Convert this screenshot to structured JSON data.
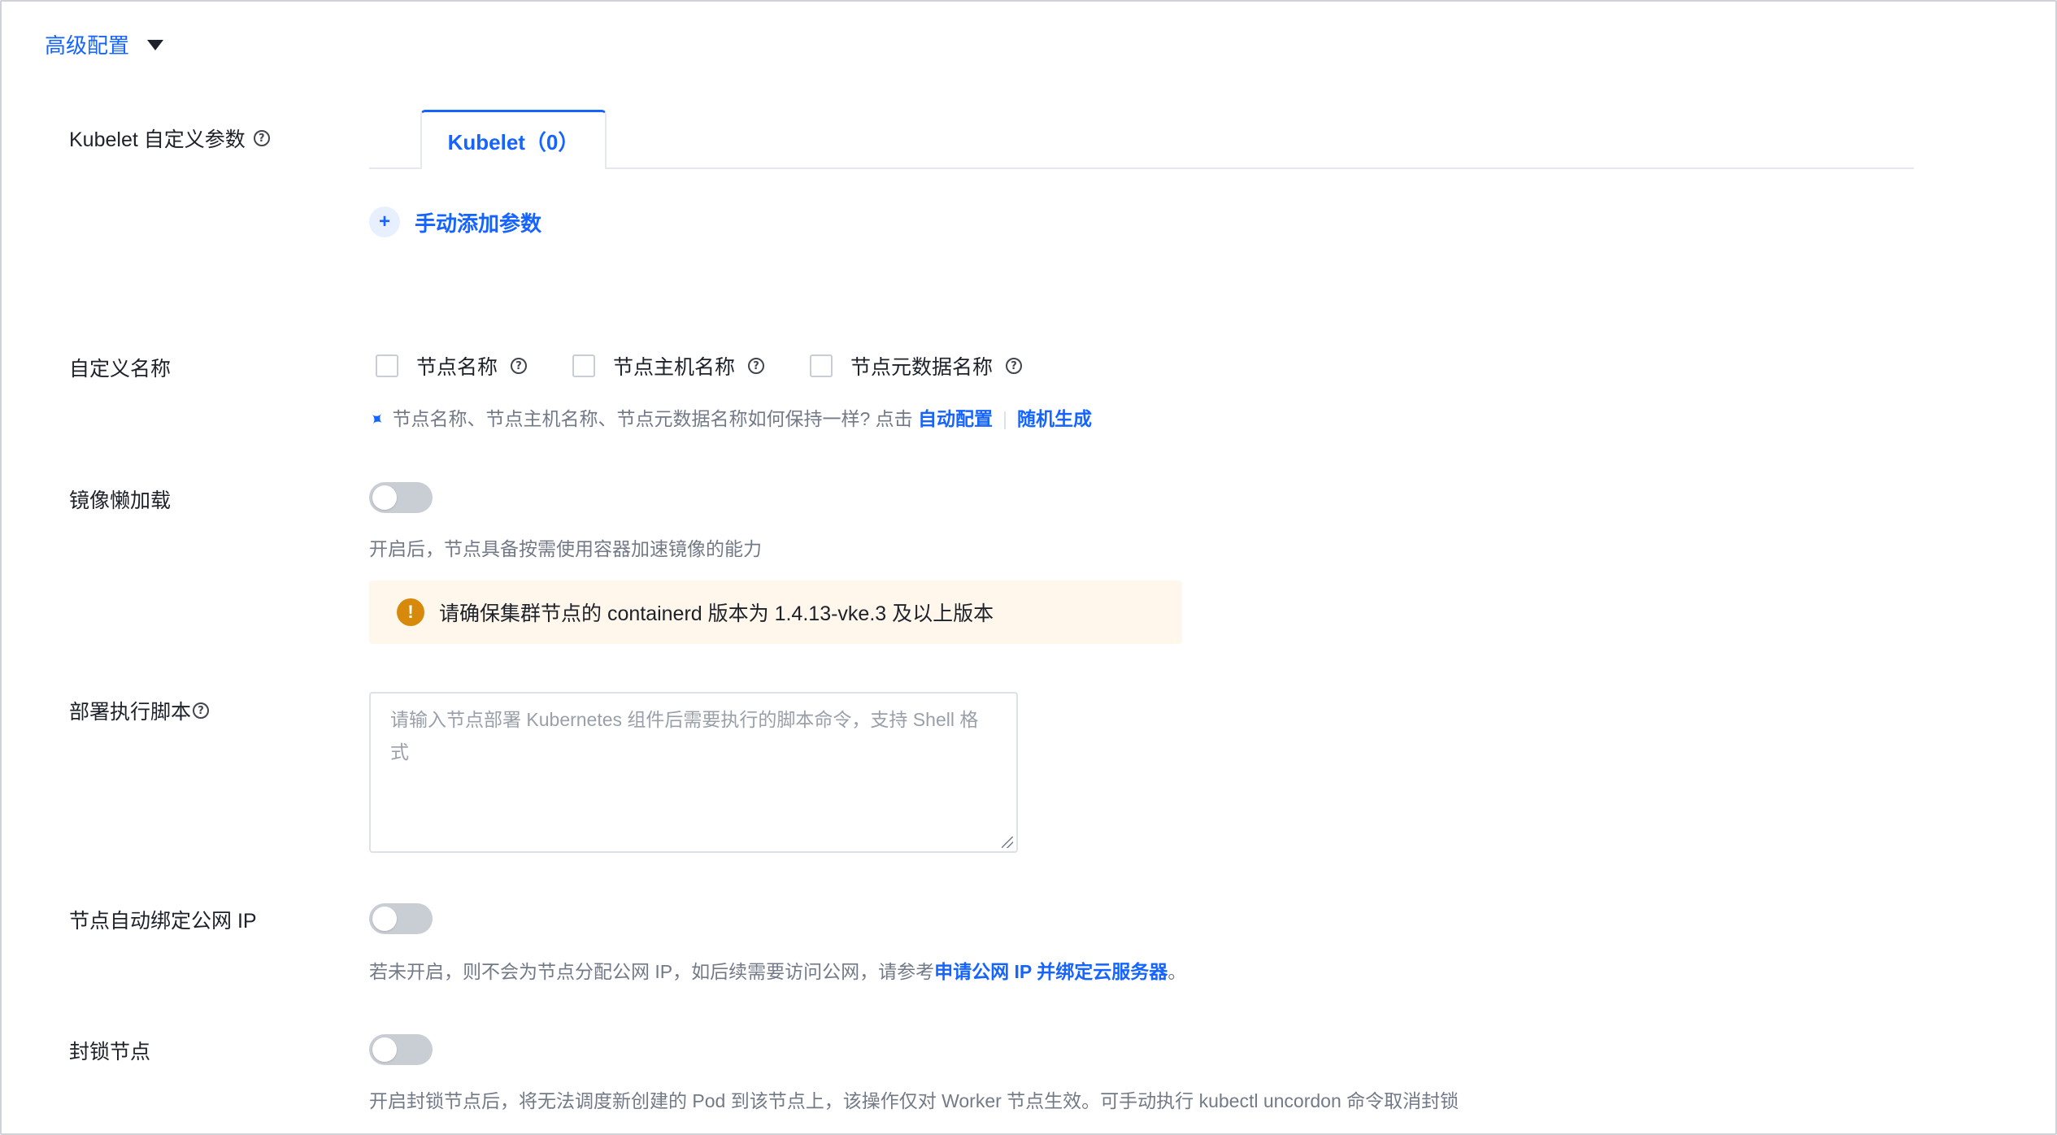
{
  "section": {
    "title": "高级配置"
  },
  "kubelet": {
    "label": "Kubelet 自定义参数",
    "tab_label": "Kubelet（0）",
    "add_param_label": "手动添加参数"
  },
  "custom_name": {
    "label": "自定义名称",
    "checkboxes": [
      {
        "label": "节点名称",
        "checked": false
      },
      {
        "label": "节点主机名称",
        "checked": false
      },
      {
        "label": "节点元数据名称",
        "checked": false
      }
    ],
    "hint": "节点名称、节点主机名称、节点元数据名称如何保持一样? 点击",
    "link_auto": "自动配置",
    "link_random": "随机生成"
  },
  "lazy_load": {
    "label": "镜像懒加载",
    "enabled": false,
    "hint": "开启后，节点具备按需使用容器加速镜像的能力",
    "warning": "请确保集群节点的 containerd 版本为 1.4.13-vke.3 及以上版本"
  },
  "deploy_script": {
    "label": "部署执行脚本",
    "placeholder": "请输入节点部署 Kubernetes 组件后需要执行的脚本命令，支持 Shell 格式"
  },
  "public_ip": {
    "label": "节点自动绑定公网 IP",
    "enabled": false,
    "hint_prefix": "若未开启，则不会为节点分配公网 IP，如后续需要访问公网，请参考",
    "link": "申请公网 IP 并绑定云服务器",
    "hint_suffix": "。"
  },
  "cordon": {
    "label": "封锁节点",
    "enabled": false,
    "hint": "开启封锁节点后，将无法调度新创建的 Pod 到该节点上，该操作仅对 Worker 节点生效。可手动执行 kubectl uncordon 命令取消封锁"
  },
  "colors": {
    "primary": "#1664ff",
    "warning_bg": "#fff7eb",
    "warning_icon": "#d6890a",
    "switch_off": "#c9cdd4"
  }
}
